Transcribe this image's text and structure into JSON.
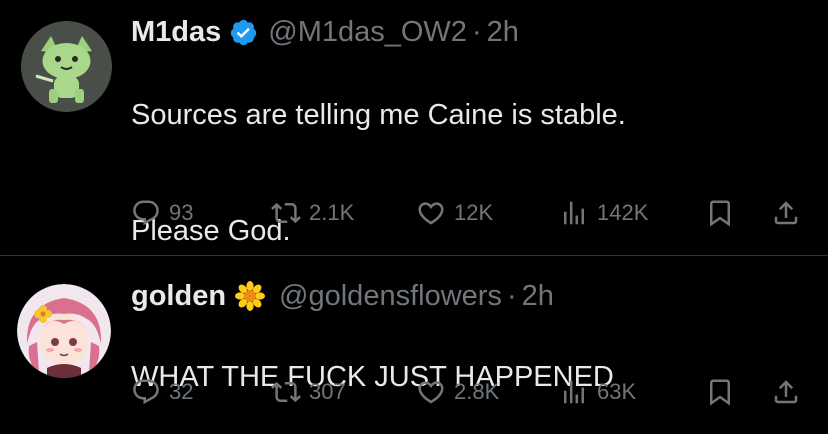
{
  "tweets": [
    {
      "name": "M1das",
      "verified": true,
      "handle": "@M1das_OW2",
      "separator": "·",
      "time": "2h",
      "text_lines": [
        "Sources are telling me Caine is stable.",
        "Please God."
      ],
      "stats": {
        "replies": "93",
        "reposts": "2.1K",
        "likes": "12K",
        "views": "142K"
      },
      "avatar_icon": "green-cat-avatar"
    },
    {
      "name": "golden",
      "emoji_icon": "sunflower-icon",
      "handle": "@goldensflowers",
      "separator": "·",
      "time": "2h",
      "text_lines": [
        "WHAT THE FUCK JUST HAPPENED"
      ],
      "stats": {
        "replies": "32",
        "reposts": "307",
        "likes": "2.8K",
        "views": "63K"
      },
      "avatar_icon": "anime-girl-avatar"
    }
  ],
  "colors": {
    "background": "#000000",
    "text_primary": "#e7e9ea",
    "text_secondary": "#71767b",
    "verified_blue": "#1d9bf0",
    "divider": "#2f3336"
  }
}
